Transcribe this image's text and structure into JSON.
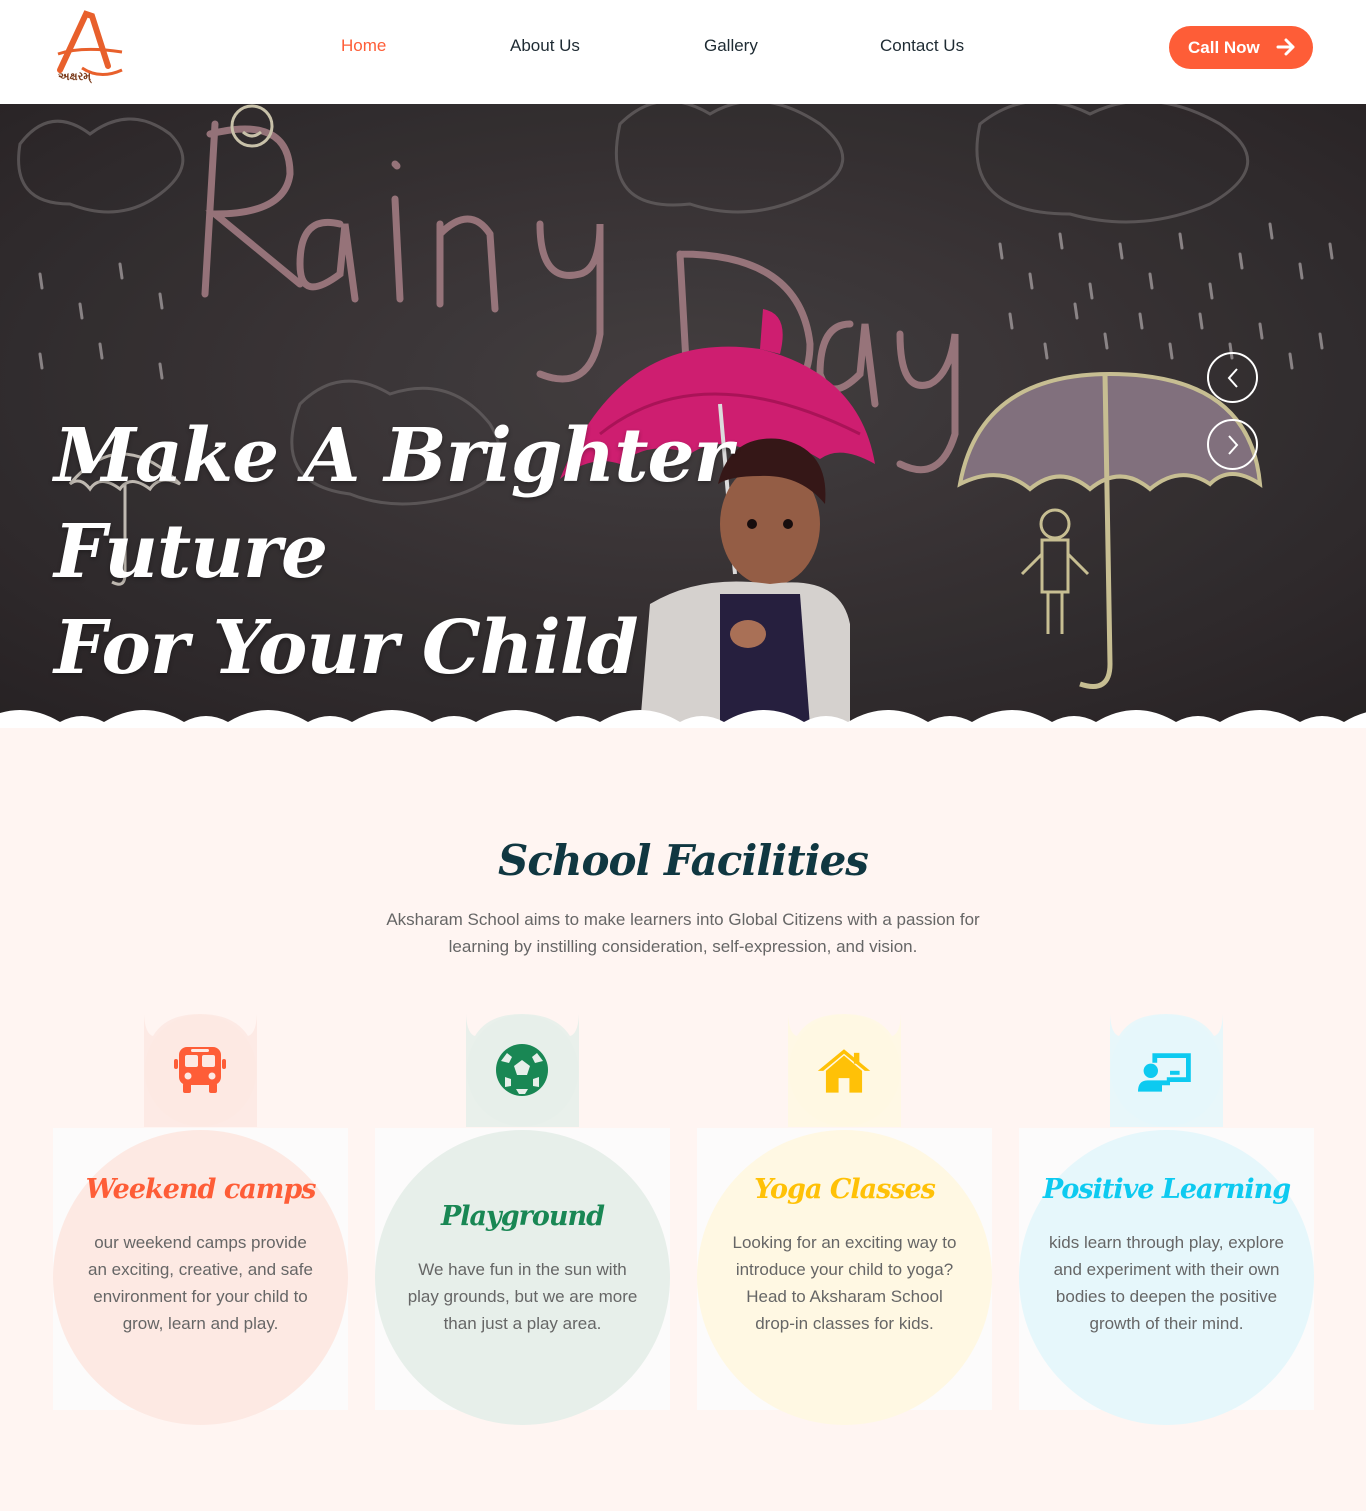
{
  "brand": {
    "logo_letter": "A",
    "logo_text": "અક્ષરમ્"
  },
  "nav": {
    "items": [
      {
        "label": "Home",
        "active": true
      },
      {
        "label": "About Us",
        "active": false
      },
      {
        "label": "Gallery",
        "active": false
      },
      {
        "label": "Contact Us",
        "active": false
      }
    ],
    "cta_label": "Call Now"
  },
  "hero": {
    "title_line1": "Make A Brighter Future",
    "title_line2": "For Your Child"
  },
  "facilities": {
    "title": "School Facilities",
    "description": "Aksharam School aims to make learners into Global Citizens with a passion for learning by instilling consideration, self-expression, and vision.",
    "cards": [
      {
        "title": "Weekend camps",
        "text": "our weekend camps provide an exciting, creative, and safe environment for your child to grow, learn and play.",
        "icon": "bus-icon",
        "color": "#fe5d37",
        "tint": "#fde9e3"
      },
      {
        "title": "Playground",
        "text": "We have fun in the sun with play grounds, but we are more than just a play area.",
        "icon": "soccer-ball-icon",
        "color": "#198754",
        "tint": "#e7efea"
      },
      {
        "title": "Yoga Classes",
        "text": "Looking for an exciting way to introduce your child to yoga? Head to Aksharam School drop-in classes for kids.",
        "icon": "home-icon",
        "color": "#ffc107",
        "tint": "#fff8e3"
      },
      {
        "title": "Positive Learning",
        "text": "kids learn through play, explore and experiment with their own bodies to deepen the positive growth of their mind.",
        "icon": "chalkboard-teacher-icon",
        "color": "#0dcaf0",
        "tint": "#e6f7fb"
      }
    ]
  },
  "colors": {
    "primary": "#fe5d37",
    "dark": "#103741",
    "section_bg": "#fff5f2"
  }
}
